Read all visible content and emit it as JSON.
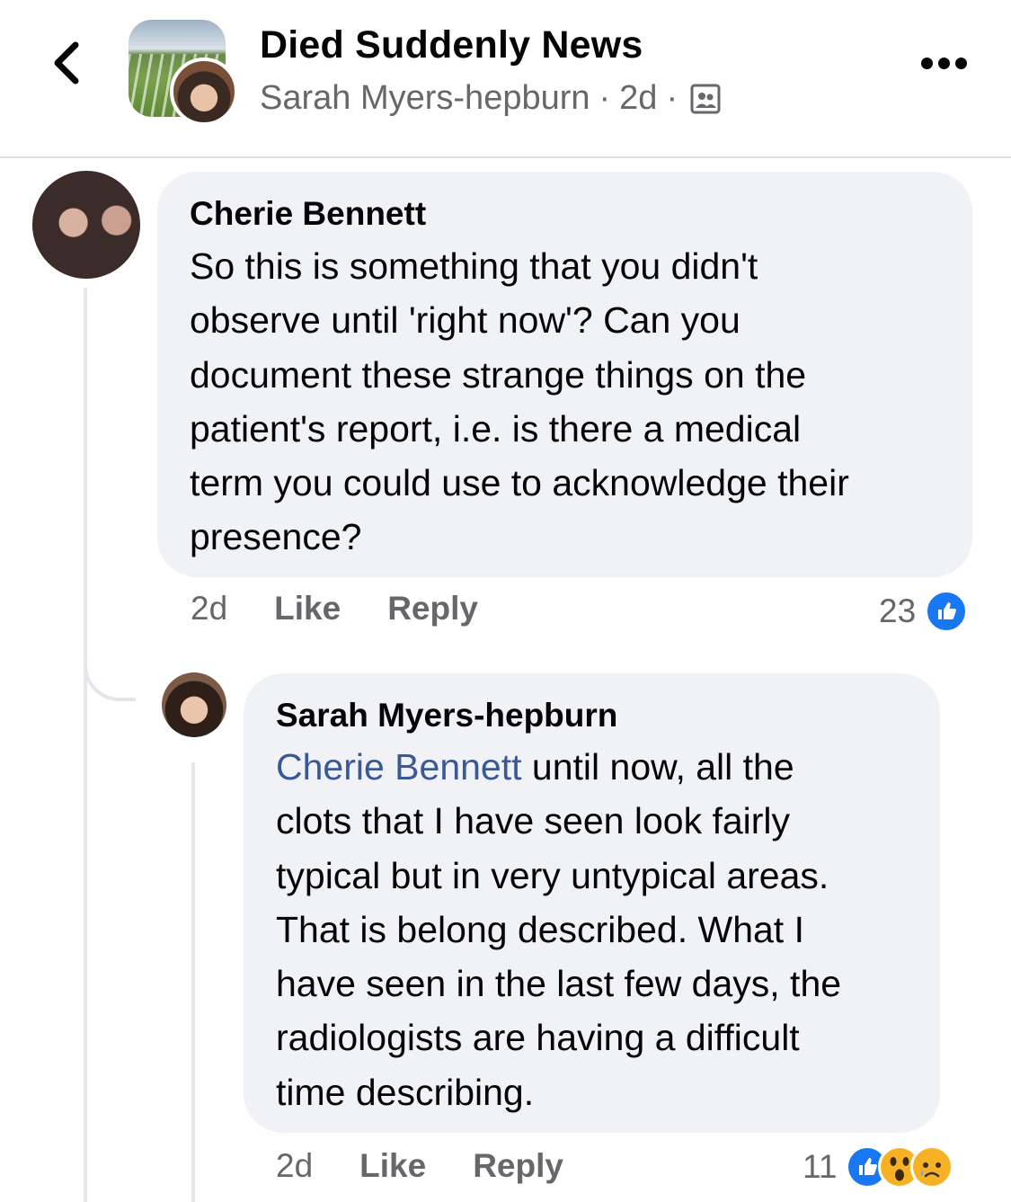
{
  "header": {
    "group_name": "Died Suddenly News",
    "poster_name": "Sarah Myers-hepburn",
    "separator": "·",
    "post_age": "2d",
    "icons": {
      "back": "chevron-left-icon",
      "more": "more-dots-icon",
      "visibility": "group-members-icon"
    }
  },
  "comments": [
    {
      "author": "Cherie Bennett",
      "body_lines": [
        "So this is something that you didn't",
        "observe until 'right now'?  Can you",
        "document these strange things on the",
        "patient's report, i.e. is there a medical",
        "term you could use to acknowledge their",
        "presence?"
      ],
      "time": "2d",
      "like_label": "Like",
      "reply_label": "Reply",
      "reaction_count": "23",
      "reactions": [
        "like"
      ]
    },
    {
      "author": "Sarah Myers-hepburn",
      "mention": "Cherie Bennett",
      "first_line_rest": " until now, all the",
      "body_lines": [
        "clots that I have seen look fairly",
        "typical but in very untypical areas.",
        "That is belong described. What I",
        "have seen in the last few days, the",
        "radiologists are having a difficult",
        "time describing."
      ],
      "time": "2d",
      "like_label": "Like",
      "reply_label": "Reply",
      "reaction_count": "11",
      "reactions": [
        "like",
        "wow",
        "sad"
      ]
    }
  ],
  "colors": {
    "mention": "#385898",
    "bubble": "#f0f2f5",
    "like_blue": "#1877f2",
    "meta_gray": "#65676b"
  }
}
